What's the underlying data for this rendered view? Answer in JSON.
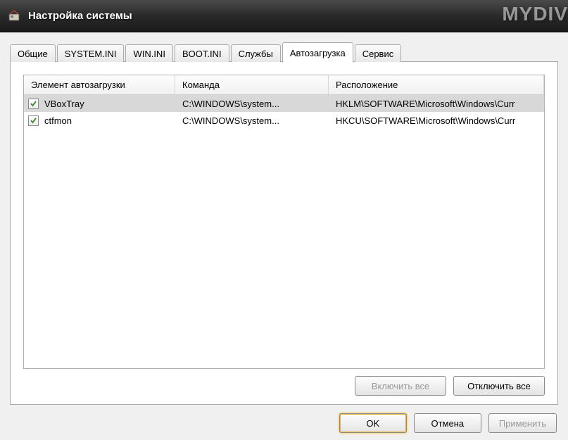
{
  "watermark": "MYDIV",
  "window": {
    "title": "Настройка системы"
  },
  "tabs": {
    "items": [
      {
        "label": "Общие"
      },
      {
        "label": "SYSTEM.INI"
      },
      {
        "label": "WIN.INI"
      },
      {
        "label": "BOOT.INI"
      },
      {
        "label": "Службы"
      },
      {
        "label": "Автозагрузка"
      },
      {
        "label": "Сервис"
      }
    ],
    "active_index": 5
  },
  "listview": {
    "columns": {
      "name": "Элемент автозагрузки",
      "command": "Команда",
      "location": "Расположение"
    },
    "rows": [
      {
        "checked": true,
        "selected": true,
        "name": "VBoxTray",
        "command": "C:\\WINDOWS\\system...",
        "location": "HKLM\\SOFTWARE\\Microsoft\\Windows\\Curr"
      },
      {
        "checked": true,
        "selected": false,
        "name": "ctfmon",
        "command": "C:\\WINDOWS\\system...",
        "location": "HKCU\\SOFTWARE\\Microsoft\\Windows\\Curr"
      }
    ]
  },
  "tab_buttons": {
    "enable_all": "Включить все",
    "disable_all": "Отключить все"
  },
  "dialog_buttons": {
    "ok": "OK",
    "cancel": "Отмена",
    "apply": "Применить"
  }
}
